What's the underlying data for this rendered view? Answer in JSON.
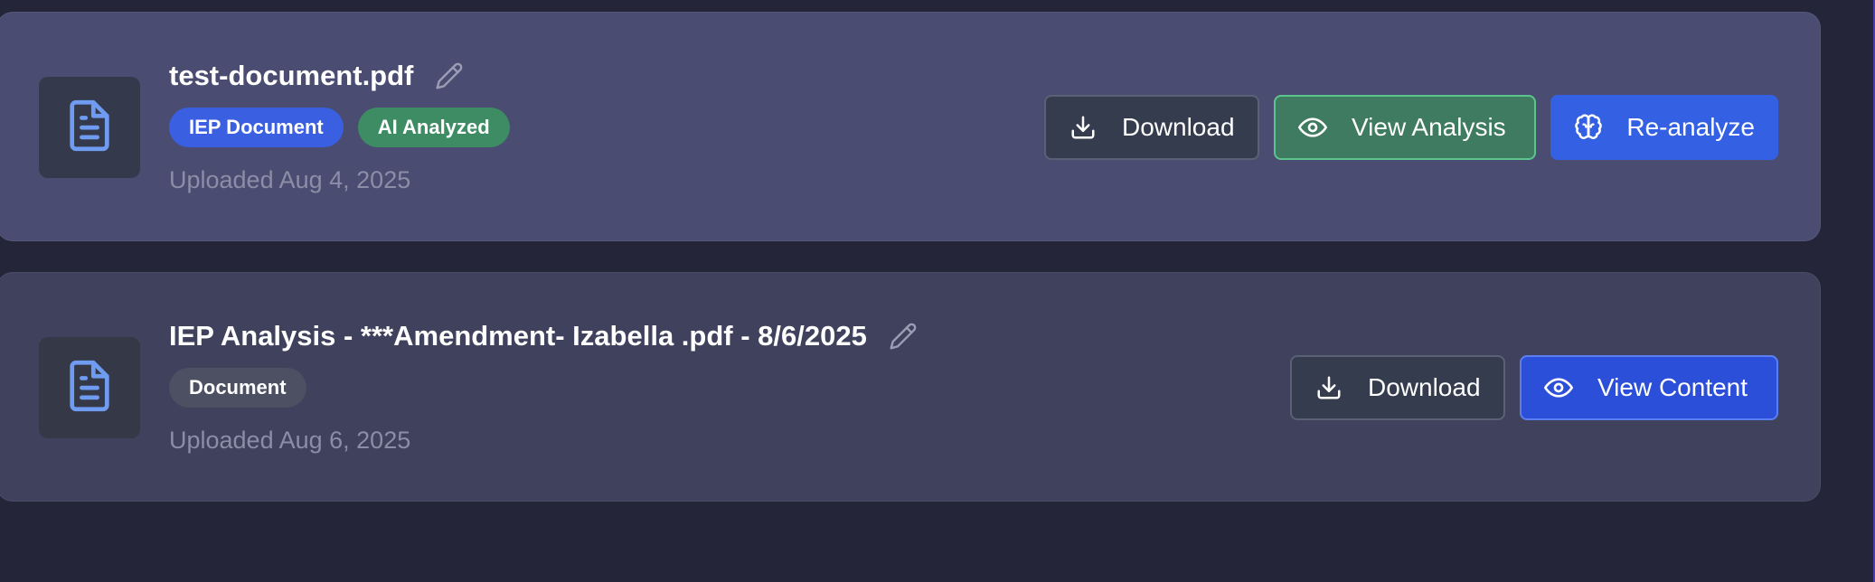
{
  "colors": {
    "page_background": "#242538",
    "card1_background": "#4a4d71",
    "card2_background": "#3f415d",
    "file_icon": "#6f9cf0",
    "badge_iep": "#3a5fe0",
    "badge_ai": "#3d8c63",
    "badge_document": "#4c5062"
  },
  "documents": [
    {
      "title": "test-document.pdf",
      "icon": "file-text-icon",
      "badges": [
        {
          "label": "IEP Document",
          "color": "#3a5fe0"
        },
        {
          "label": "AI Analyzed",
          "color": "#3d8c63"
        }
      ],
      "uploaded": "Uploaded Aug 4, 2025",
      "actions": {
        "download": {
          "label": "Download",
          "icon": "download-icon"
        },
        "view_analysis": {
          "label": "View Analysis",
          "icon": "eye-icon"
        },
        "reanalyze": {
          "label": "Re-analyze",
          "icon": "brain-icon"
        }
      }
    },
    {
      "title": "IEP Analysis - ***Amendment- Izabella .pdf - 8/6/2025",
      "icon": "file-text-icon",
      "badges": [
        {
          "label": "Document",
          "color": "#4c5062"
        }
      ],
      "uploaded": "Uploaded Aug 6, 2025",
      "actions": {
        "download": {
          "label": "Download",
          "icon": "download-icon"
        },
        "view_content": {
          "label": "View Content",
          "icon": "eye-icon"
        }
      }
    }
  ]
}
